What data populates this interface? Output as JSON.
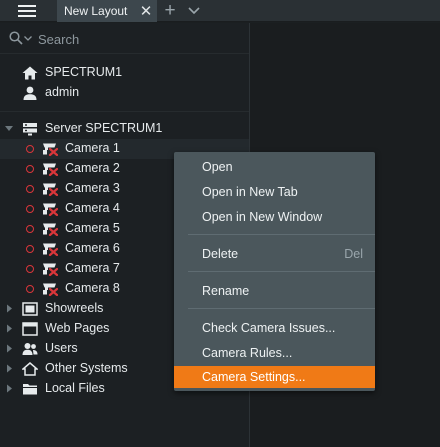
{
  "titlebar": {
    "menu_icon": "hamburger-icon",
    "tab_label": "New Layout",
    "tab_close_icon": "close-icon",
    "new_tab_icon": "plus-icon",
    "tabs_dropdown_icon": "chevron-down-icon"
  },
  "search": {
    "placeholder": "Search",
    "value": ""
  },
  "server_info": {
    "system_name": "SPECTRUM1",
    "user": "admin"
  },
  "tree": {
    "server": {
      "label": "Server SPECTRUM1",
      "expanded": true
    },
    "cameras": [
      {
        "label": "Camera 1",
        "status": "offline"
      },
      {
        "label": "Camera 2",
        "status": "offline"
      },
      {
        "label": "Camera 3",
        "status": "offline"
      },
      {
        "label": "Camera 4",
        "status": "offline"
      },
      {
        "label": "Camera 5",
        "status": "offline"
      },
      {
        "label": "Camera 6",
        "status": "offline"
      },
      {
        "label": "Camera 7",
        "status": "offline"
      },
      {
        "label": "Camera 8",
        "status": "offline"
      }
    ],
    "groups": [
      {
        "label": "Showreels",
        "icon": "showreels-icon"
      },
      {
        "label": "Web Pages",
        "icon": "web-pages-icon"
      },
      {
        "label": "Users",
        "icon": "users-icon"
      },
      {
        "label": "Other Systems",
        "icon": "other-systems-icon"
      },
      {
        "label": "Local Files",
        "icon": "folder-icon"
      }
    ]
  },
  "context_menu": {
    "items": [
      {
        "label": "Open",
        "shortcut": ""
      },
      {
        "label": "Open in New Tab",
        "shortcut": ""
      },
      {
        "label": "Open in New Window",
        "shortcut": ""
      },
      {
        "label": "Delete",
        "shortcut": "Del"
      },
      {
        "label": "Rename",
        "shortcut": ""
      },
      {
        "label": "Check Camera Issues...",
        "shortcut": ""
      },
      {
        "label": "Camera Rules...",
        "shortcut": ""
      },
      {
        "label": "Camera Settings...",
        "shortcut": "",
        "highlighted": true
      }
    ]
  },
  "colors": {
    "accent": "#f07a16",
    "offline": "#d9363a",
    "menu_bg": "#4b575c"
  }
}
